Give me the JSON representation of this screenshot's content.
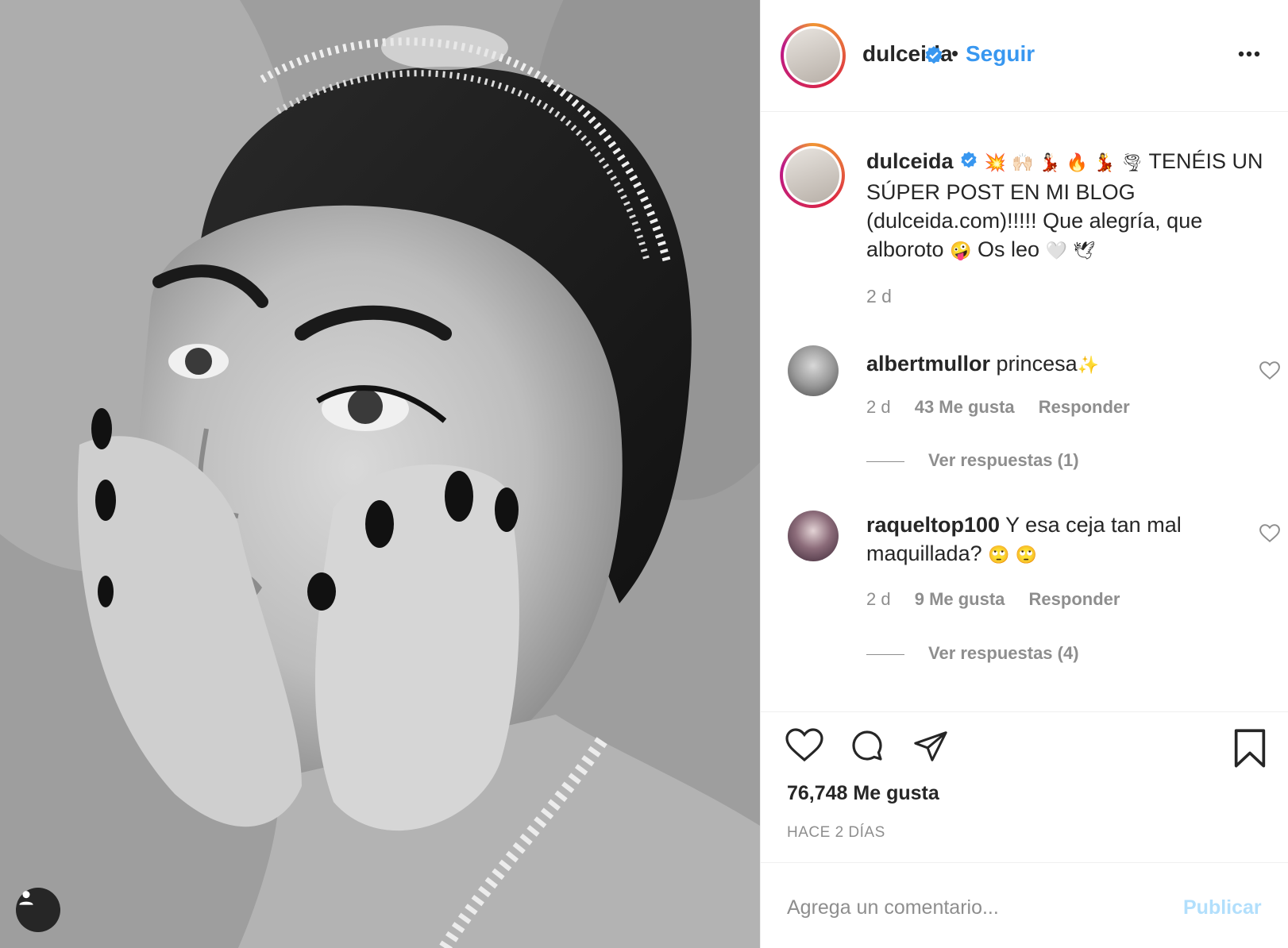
{
  "photo": {
    "alt_role": "post-photo",
    "user_tag_icon": "person-icon"
  },
  "header": {
    "username": "dulceida",
    "verified_icon": "verified-badge-icon",
    "separator": "•",
    "follow_label": "Seguir",
    "more_icon": "more-options-icon"
  },
  "caption": {
    "username": "dulceida",
    "emojis": "💥 🙌🏻 💃🏻 🔥 💃 🌪",
    "text": "TENÉIS UN SÚPER POST EN MI BLOG (dulceida.com)!!!!! Que alegría, que alboroto",
    "emoji_mid": "🤪",
    "text_end": "Os leo",
    "emoji_end": "🤍 🕊",
    "time": "2 d"
  },
  "comments": [
    {
      "username": "albertmullor",
      "text": "princesa",
      "emoji": "✨",
      "time": "2 d",
      "likes": "43 Me gusta",
      "reply": "Responder",
      "view_replies": "Ver respuestas (1)"
    },
    {
      "username": "raqueltop100",
      "text": "Y esa ceja tan mal maquillada?",
      "emoji": "🙄 🙄",
      "time": "2 d",
      "likes": "9 Me gusta",
      "reply": "Responder",
      "view_replies": "Ver respuestas (4)"
    }
  ],
  "actions": {
    "like_icon": "heart-icon",
    "comment_icon": "comment-icon",
    "share_icon": "share-icon",
    "save_icon": "bookmark-icon",
    "likes_count": "76,748 Me gusta",
    "posted_ago": "HACE 2 DÍAS"
  },
  "comment_box": {
    "placeholder": "Agrega un comentario...",
    "publish_label": "Publicar"
  },
  "colors": {
    "link_blue": "#3897f0",
    "publish_disabled": "#b2dffc",
    "muted_text": "#8e8e8e",
    "primary_text": "#262626",
    "border": "#efefef"
  }
}
